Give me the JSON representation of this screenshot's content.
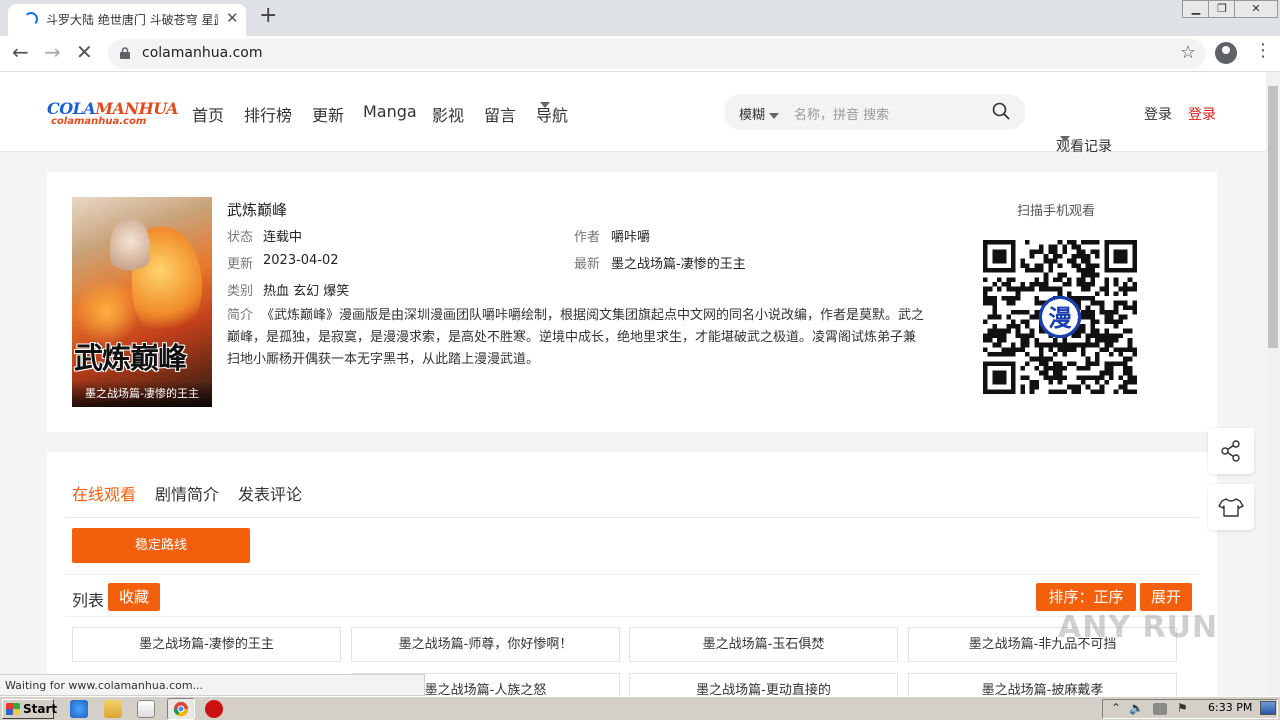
{
  "browser": {
    "tab_title": "斗罗大陆 绝世唐门 斗破苍穹 星武神",
    "url": "colamanhua.com",
    "status_text": "Waiting for www.colamanhua.com..."
  },
  "site": {
    "logo_cola": "COLA",
    "logo_manhua": "MANHUA",
    "logo_domain": "colamanhua.com",
    "nav": [
      "首页",
      "排行榜",
      "更新",
      "Manga",
      "影视",
      "留言",
      "导航"
    ],
    "search_mode": "模糊",
    "search_placeholder": "名称，拼音 搜索",
    "history": "观看记录",
    "login": "登录",
    "register": "登录"
  },
  "comic": {
    "title": "武炼巅峰",
    "status_label": "状态",
    "status": "连载中",
    "author_label": "作者",
    "author": "嚼咔嚼",
    "updated_label": "更新",
    "updated": "2023-04-02",
    "latest_label": "最新",
    "latest": "墨之战场篇-凄惨的王主",
    "category_label": "类别",
    "category": "热血 玄幻 爆笑",
    "summary_label": "简介",
    "summary": "《武炼巅峰》漫画版是由深圳漫画团队嚼咔嚼绘制，根据阅文集团旗起点中文网的同名小说改编，作者是莫默。武之巅峰，是孤独，是寂寞，是漫漫求索，是高处不胜寒。逆境中成长，绝地里求生，才能堪破武之极道。凌霄阁试炼弟子兼扫地小厮杨开偶获一本无字黑书，从此踏上漫漫武道。",
    "cover_title": "武炼巅峰",
    "cover_caption": "墨之战场篇-凄惨的王主",
    "qr_label": "扫描手机观看",
    "qr_center": "漫"
  },
  "chapters": {
    "tabs": [
      "在线观看",
      "剧情简介",
      "发表评论"
    ],
    "route_button": "稳定路线",
    "list_label": "列表",
    "favorite": "收藏",
    "sort": "排序：正序",
    "expand": "展开",
    "items": [
      "墨之战场篇-凄惨的王主",
      "墨之战场篇-师尊，你好惨啊！",
      "墨之战场篇-玉石俱焚",
      "墨之战场篇-非九品不可挡",
      "墨之战场篇-人族之怒",
      "墨之战场篇-更动直接的",
      "墨之战场篇-披麻戴孝"
    ]
  },
  "watermark": "ANY RUN",
  "taskbar": {
    "start": "Start",
    "clock": "6:33 PM"
  },
  "colors": {
    "accent": "#f45f0c",
    "register": "#e0201c",
    "logo_blue": "#1a5fd0",
    "logo_red": "#e24a1c"
  }
}
